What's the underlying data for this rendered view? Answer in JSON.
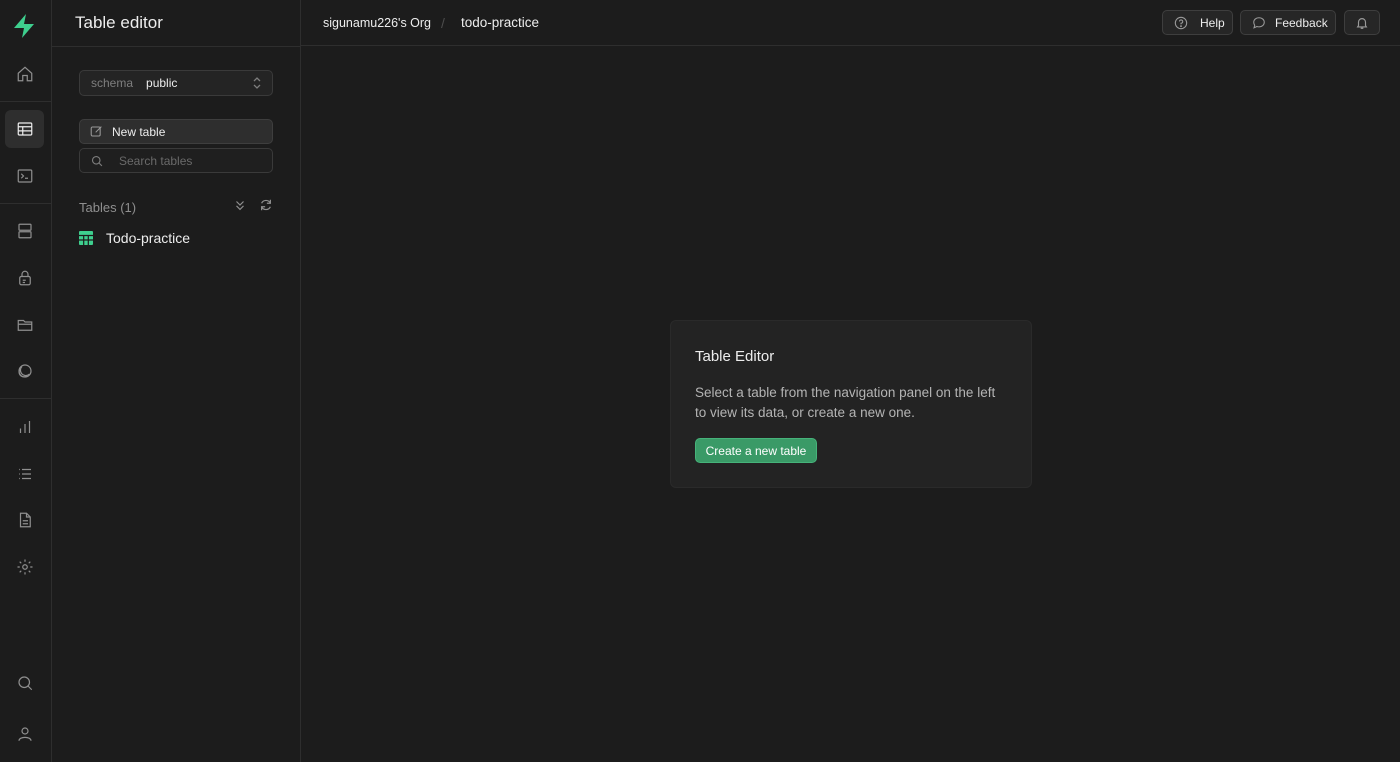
{
  "sidebar": {
    "title": "Table editor",
    "schema": {
      "label": "schema",
      "value": "public"
    },
    "new_table_label": "New table",
    "search_placeholder": "Search tables",
    "tables_heading": "Tables (1)",
    "tables": [
      {
        "name": "Todo-practice"
      }
    ]
  },
  "topbar": {
    "org": "sigunamu226's Org",
    "separator": "/",
    "project": "todo-practice",
    "help_label": "Help",
    "feedback_label": "Feedback"
  },
  "main": {
    "card_title": "Table Editor",
    "card_description": "Select a table from the navigation panel on the left to view its data, or create a new one.",
    "create_button_label": "Create a new table"
  },
  "rail": {
    "items": [
      {
        "icon": "home-icon"
      },
      {
        "icon": "table-editor-icon",
        "active": true
      },
      {
        "icon": "sql-editor-icon"
      },
      {
        "icon": "database-icon"
      },
      {
        "icon": "authentication-icon"
      },
      {
        "icon": "storage-icon"
      },
      {
        "icon": "realtime-icon"
      },
      {
        "icon": "reports-icon"
      },
      {
        "icon": "logs-icon"
      },
      {
        "icon": "api-docs-icon"
      },
      {
        "icon": "settings-icon"
      },
      {
        "icon": "search-icon"
      },
      {
        "icon": "user-icon"
      }
    ]
  },
  "colors": {
    "background": "#1c1c1c",
    "accent_green": "#3ecf8e",
    "button_green": "#3a9a67"
  }
}
